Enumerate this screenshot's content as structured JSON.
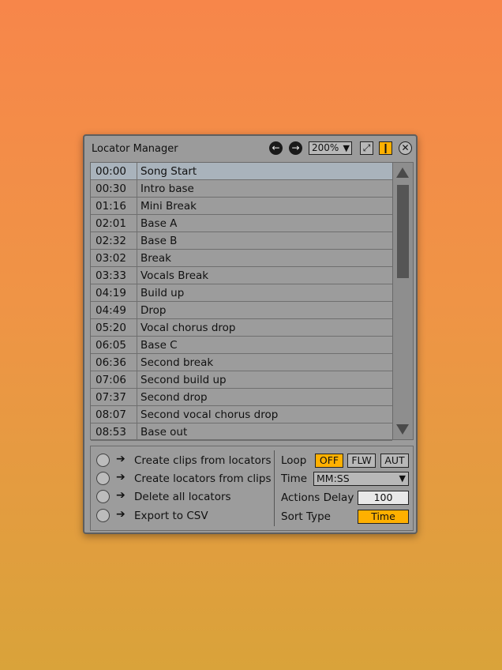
{
  "window": {
    "title": "Locator Manager",
    "zoom": "200%",
    "icons": [
      "arrow-left-icon",
      "arrow-right-icon",
      "chevron-down-icon",
      "expand-icon",
      "pin-icon",
      "close-icon"
    ]
  },
  "locators": [
    {
      "time": "00:00",
      "name": "Song Start"
    },
    {
      "time": "00:30",
      "name": "Intro base"
    },
    {
      "time": "01:16",
      "name": "Mini Break"
    },
    {
      "time": "02:01",
      "name": "Base A"
    },
    {
      "time": "02:32",
      "name": "Base B"
    },
    {
      "time": "03:02",
      "name": "Break"
    },
    {
      "time": "03:33",
      "name": "Vocals Break"
    },
    {
      "time": "04:19",
      "name": "Build up"
    },
    {
      "time": "04:49",
      "name": "Drop"
    },
    {
      "time": "05:20",
      "name": "Vocal chorus drop"
    },
    {
      "time": "06:05",
      "name": "Base C"
    },
    {
      "time": "06:36",
      "name": "Second break"
    },
    {
      "time": "07:06",
      "name": "Second build up"
    },
    {
      "time": "07:37",
      "name": "Second drop"
    },
    {
      "time": "08:07",
      "name": "Second vocal chorus drop"
    },
    {
      "time": "08:53",
      "name": "Base out"
    }
  ],
  "actions": [
    {
      "label": "Create clips from locators"
    },
    {
      "label": "Create locators from clips"
    },
    {
      "label": "Delete all locators"
    },
    {
      "label": "Export to CSV"
    }
  ],
  "options": {
    "loop_label": "Loop",
    "loop_off": "OFF",
    "loop_flw": "FLW",
    "loop_aut": "AUT",
    "time_label": "Time",
    "time_value": "MM:SS",
    "delay_label": "Actions Delay",
    "delay_value": "100",
    "sort_label": "Sort Type",
    "sort_value": "Time"
  },
  "colors": {
    "accent": "#ffb000",
    "panel": "#9b9b9b",
    "selected_row": "#a9b3bc"
  }
}
